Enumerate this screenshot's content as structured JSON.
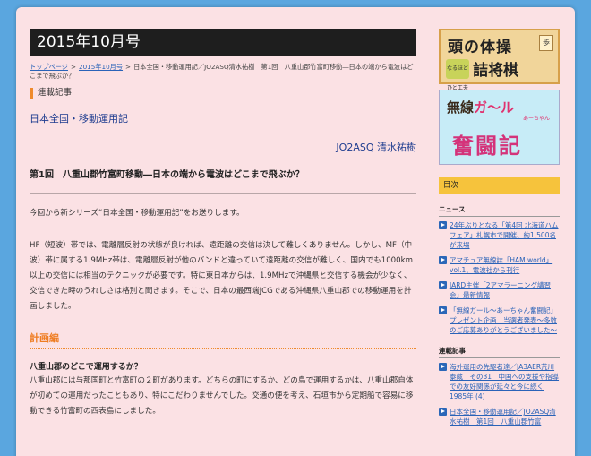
{
  "header": {
    "issue": "2015年10月号"
  },
  "breadcrumb": {
    "top": "トップページ",
    "issue": "2015年10月号",
    "current": "日本全国・移動運用記／JO2ASQ清水祐樹　第1回　八重山郡竹富町移動―日本の端から電波はどこまで飛ぶか？"
  },
  "section_label": "連載記事",
  "article": {
    "series": "日本全国・移動運用記",
    "author": "JO2ASQ 清水祐樹",
    "title": "第1回　八重山郡竹富町移動―日本の端から電波はどこまで飛ぶか？",
    "intro": "今回から新シリーズ“日本全国・移動運用記”をお送りします。",
    "para2": "HF（短波）帯では、電離層反射の状態が良ければ、遠距離の交信は決して難しくありません。しかし、MF（中波）帯に属する1.9MHz帯は、電離層反射が他のバンドと違っていて遠距離の交信が難しく、国内でも1000km以上の交信には相当のテクニックが必要です。特に東日本からは、1.9MHzで沖縄県と交信する機会が少なく、交信できた時のうれしさは格別と聞きます。そこで、日本の最西端JCGである沖縄県八重山郡での移動運用を計画しました。",
    "plan_heading": "計画編",
    "sub_heading": "八重山郡のどこで運用するか？",
    "para3": "八重山郡には与那国町と竹富町の２町があります。どちらの町にするか、どの島で運用するかは、八重山郡自体が初めての運用だったこともあり、特にこだわりませんでした。交通の便を考え、石垣市から定期船で容易に移動できる竹富町の西表島にしました。"
  },
  "sidebar": {
    "banner1": {
      "main": "頭の体操",
      "sub": "詰将棋",
      "badge": "なるほどひと工夫",
      "piece": "歩"
    },
    "banner2": {
      "top_a": "無線",
      "top_b": "ガ～ル",
      "small": "あーちゃん",
      "main": "奮闘記"
    },
    "mokuji": "目次",
    "news_heading": "ニュース",
    "news": [
      "24年ぶりとなる「第4回 北海道ハムフェア」札幌市で開催、約1,500名が来場",
      "アマチュア無線誌「HAM world」vol.1、電波社から刊行",
      "JARD主催「2アマラーニング講習会」最新情報",
      "「無線ガール～あーちゃん奮闘記」プレゼント企画　当選者発表～多数のご応募ありがとうございました～"
    ],
    "series_heading": "連載記事",
    "series": [
      "海外運用の先駆者達／JA3AER荒川泰蔵　その31　中国への支援や指導での友好関係が延々と今に続く 1985年 (4)",
      "日本全国・移動運用記／JO2ASQ清水祐樹　第1回　八重山郡竹富"
    ]
  }
}
